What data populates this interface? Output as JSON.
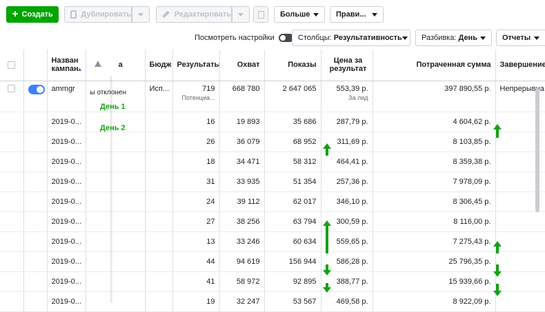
{
  "toolbar": {
    "create": "Создать",
    "duplicate": "Дублировать",
    "edit": "Редактировать",
    "more": "Больше",
    "rules": "Прави..."
  },
  "bar2": {
    "view_settings": "Посмотреть настройки",
    "columns_prefix": "Столбцы:",
    "columns_value": "Результативность",
    "breakdown_prefix": "Разбивка:",
    "breakdown_value": "День",
    "reports": "Отчеты"
  },
  "headers": {
    "name": "Назван кампан",
    "delivery": "а",
    "budget": "Бюдж",
    "results": "Результаты",
    "reach": "Охват",
    "impressions": "Показы",
    "cost_per_result": "Цена за результат",
    "amount_spent": "Потраченная сумма",
    "ends": "Завершение"
  },
  "summary": {
    "name": "ammgr",
    "delivery": "ы отклонен",
    "budget": "Исп...",
    "results": "719",
    "results_sub": "Потенциа...",
    "reach": "668 780",
    "impressions": "2 647 065",
    "cost": "553,39 р.",
    "cost_sub": "За лид",
    "spent": "397 890,55 р.",
    "ends": "Непрерывна"
  },
  "rows": [
    {
      "date": "2019-0...",
      "results": "16",
      "reach": "19 893",
      "impressions": "35 686",
      "cost": "287,79 р.",
      "spent": "4 604,62 р."
    },
    {
      "date": "2019-0...",
      "results": "26",
      "reach": "36 079",
      "impressions": "68 952",
      "cost": "311,69 р.",
      "spent": "8 103,85 р."
    },
    {
      "date": "2019-0...",
      "results": "18",
      "reach": "34 471",
      "impressions": "58 312",
      "cost": "464,41 р.",
      "spent": "8 359,38 р."
    },
    {
      "date": "2019-0...",
      "results": "31",
      "reach": "33 935",
      "impressions": "51 354",
      "cost": "257,36 р.",
      "spent": "7 978,09 р."
    },
    {
      "date": "2019-0...",
      "results": "24",
      "reach": "39 112",
      "impressions": "62 017",
      "cost": "346,10 р.",
      "spent": "8 306,45 р."
    },
    {
      "date": "2019-0...",
      "results": "27",
      "reach": "38 256",
      "impressions": "63 794",
      "cost": "300,59 р.",
      "spent": "8 116,00 р."
    },
    {
      "date": "2019-0...",
      "results": "13",
      "reach": "33 246",
      "impressions": "60 634",
      "cost": "559,65 р.",
      "spent": "7 275,43 р."
    },
    {
      "date": "2019-0...",
      "results": "44",
      "reach": "94 619",
      "impressions": "156 944",
      "cost": "586,28 р.",
      "spent": "25 796,35 р."
    },
    {
      "date": "2019-0...",
      "results": "41",
      "reach": "58 972",
      "impressions": "92 895",
      "cost": "388,77 р.",
      "spent": "15 939,66 р."
    },
    {
      "date": "2019-0...",
      "results": "19",
      "reach": "32 247",
      "impressions": "53 567",
      "cost": "469,58 р.",
      "spent": "8 922,09 р."
    }
  ],
  "annotations": {
    "day1": "День 1",
    "day2": "День 2",
    "color": "#16a016"
  },
  "colors": {
    "create_button": "#00a400",
    "link": "#4267b2"
  }
}
